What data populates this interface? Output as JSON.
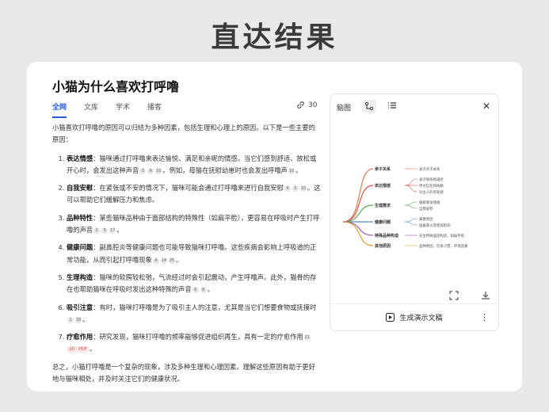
{
  "banner": "直达结果",
  "question": "小猫为什么喜欢打呼噜",
  "tabs": [
    "全网",
    "文库",
    "学术",
    "播客"
  ],
  "source_count": "30",
  "intro": "小猫喜欢打呼噜的原因可以归结为多种因素，包括生理和心理上的原因。以下是一些主要的原因：",
  "items": [
    {
      "title": "表达情感",
      "text": "：猫咪通过打呼噜来表达愉悦、满足和亲昵的情感。当它们感到舒适、放松或开心时，会发出这种声音",
      "cites": [
        "3",
        "6",
        "10"
      ],
      "text2": "。例如，母猫在抚慰幼崽时也会发出呼噜声",
      "cites2": [
        "10"
      ],
      "end": "。"
    },
    {
      "title": "自我安慰",
      "text": "：在紧张或不安的情况下，猫咪可能会通过打呼噜来进行自我安慰",
      "cites": [
        "4",
        "5",
        "10"
      ],
      "text2": "。这可以帮助它们缓解压力和焦虑。",
      "cites2": [],
      "end": ""
    },
    {
      "title": "品种特性",
      "text": "：某些猫咪品种由于面部结构的特殊性（如扁平脸），更容易在呼吸时产生打呼噜的声音",
      "cites": [
        "2",
        "5",
        "17"
      ],
      "text2": "。",
      "cites2": [],
      "end": ""
    },
    {
      "title": "健康问题",
      "text": "：副鼻腔炎等健康问题也可能导致猫咪打呼噜。这些疾病会影响上呼吸道的正常功能，从而引起打呼噜现象",
      "cites": [
        "4",
        "14",
        "25"
      ],
      "text2": "。",
      "cites2": [],
      "end": ""
    },
    {
      "title": "生理构造",
      "text": "：猫咪的软腭较松弛，气流经过时会引起震动，产生呼噜声。此外，猫骨的存在也帮助猫咪在呼吸时发出这种特殊的声音",
      "cites": [
        "6",
        "8"
      ],
      "text2": "。",
      "cites2": [],
      "end": ""
    },
    {
      "title": "吸引注意",
      "text": "：有时，猫咪打呼噜是为了吸引主人的注意，尤其是当它们想要食物或抚摸时",
      "cites": [
        "1",
        "18"
      ],
      "text2": "。",
      "cites2": [],
      "end": ""
    },
    {
      "title": "疗愈作用",
      "text": "：研究发现，猫咪打呼噜的频率能够促进组织再生，具有一定的疗愈作用",
      "cites": [
        "21"
      ],
      "text2": "",
      "cites2": [],
      "pdf": "20 · PDF",
      "end": "。"
    }
  ],
  "summary": "总之，小猫打呼噜是一个复杂的现象，涉及多种生理和心理因素。理解这些原因有助于更好地与猫咪相处，并及时关注它们的健康状况。",
  "panel": {
    "label": "脑图",
    "footer": "生成演示文稿",
    "mindmap": [
      {
        "name": "亲子关系",
        "leaves": [
          "表示亲子关系"
        ]
      },
      {
        "name": "表达情感",
        "leaves": [
          "表示愉快和满足",
          "传达信任和依赖",
          "对主人的亲昵感"
        ]
      },
      {
        "name": "生理需求",
        "leaves": [
          "缓解紧张情绪",
          "自我安慰"
        ]
      },
      {
        "name": "健康问题",
        "leaves": [
          "鼻塞原因",
          "副鼻窦炎等疾病影响"
        ]
      },
      {
        "name": "特殊品种构造",
        "leaves": [
          "天生特殊面部构造，如扁平脸"
        ]
      },
      {
        "name": "其他原因",
        "leaves": [
          "品种原因、饮食习惯、环境因素"
        ]
      }
    ],
    "branch_color": "#f0a030"
  }
}
